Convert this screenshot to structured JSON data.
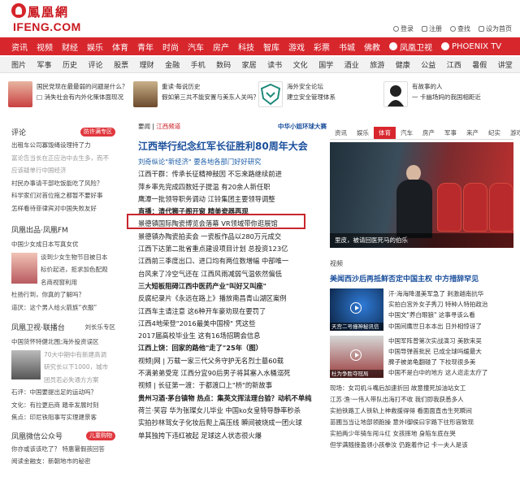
{
  "logo": {
    "cn": "鳳凰網",
    "en": "IFENG.COM"
  },
  "top_links": [
    "登录",
    "注册",
    "查找",
    "设为首页"
  ],
  "navbar": {
    "items": [
      "资讯",
      "视频",
      "财经",
      "娱乐",
      "体育",
      "青年",
      "时尚",
      "汽车",
      "房产",
      "科技",
      "智库",
      "游戏",
      "彩票",
      "书城",
      "佛教"
    ],
    "ext1": "凤凰卫视",
    "ext2": "PHOENIX TV"
  },
  "subnav": [
    "图片",
    "军事",
    "历史",
    "评论",
    "股票",
    "理财",
    "金融",
    "手机",
    "数码",
    "家居",
    "读书",
    "文化",
    "国学",
    "酒业",
    "旅游",
    "健康",
    "公益",
    "江西",
    "暑假",
    "讲堂",
    "未来",
    "创新",
    "电台"
  ],
  "promo": [
    {
      "l1": "国民党现在最最弱的问题是什么？",
      "l2": "□ 消失社会有内外化策体面现况"
    },
    {
      "l1": "重读·每说历史",
      "l2": "假如第三共不能安置与美东人关吗？"
    },
    {
      "l1": "海外安全论坛",
      "l2": "建立安全管理体系"
    },
    {
      "l1": "有故事的人",
      "l2": "一 卡幽场妈的我国相距近"
    }
  ],
  "left": {
    "comment_title": "评论",
    "comment_badge": "防许满专区",
    "comment_lines": [
      "出租车公司寡毁绳设理持了力",
      "富论告当长在正应治中去生多，而不",
      "应该疑单行中国经济",
      "村民办事请干部吃饭能吃了风险？",
      "科学家们对首位拖之都暂不要好事",
      "怎样看待菲律宾对中国失败友好"
    ],
    "fm_title": "凤凰出品·凤凰FM",
    "fm_lines": [
      "中国少女成日本写真女优",
      "谈到少女生物节目被日本",
      "标价起进，拒求加色配观",
      "名商视窗利用",
      "杜扬行到，你真的了解吗？",
      "道厌：这个男人给火箭族“衣服”"
    ],
    "tv_title": "凤凰卫视·联播台",
    "tv_badge": "刘长乐专区",
    "tv_lines": [
      "中国货怀特健北围;海外投资误区",
      "70大中期中有新建高调",
      "研究长以下1000，城市",
      "团员若必失通方方案",
      "石评：中国要提出足的运动吗？",
      "文化：有拉更后商 踏幸发展时刻",
      "焦点：印尼铁阻事写实理建景客"
    ],
    "wx_title": "凤凰微信公众号",
    "wx_badge": "儿童购物",
    "wx_lines": [
      "你亦或该该吃了？ 特惠暑假孩回答",
      "阅读金融支：新朝地市的秘密"
    ]
  },
  "mid": {
    "top_left": "要闻",
    "top_tag": "江西频道",
    "top_right": "中华小姐环球大赛",
    "headline": "江西举行纪念红军长征胜利80周年大会",
    "lines": [
      "刘奇纵论\"新经济\" 要各地各部门好好研究",
      "江西干群：传承长征精神鼓因 不忘来路继续前进",
      "萍乡率先完成四数妊子提温 有20余人新任职",
      "鹰潭一批领导职务调动 江铃集团主要领导调整",
      "直播：清代狮子阁开窗 精美瓷器再现",
      "景德镇国际陶瓷博览会落幕 VR领域带你逛展馆",
      "景德镇办陶瓷拍卖会 一瓷板作品以280万元成交",
      "江西下达第二批省重点建设项目计划 总投资123亿",
      "江西前三季度出口、进口均有两位数增幅 中部唯一",
      "台风来了冷空气还在 江西风雨减弱气温依然偏低",
      "三大短板阻碍江西中医药产业\"叫好又叫座\"",
      "反腐纪录片《永远在路上》播放南昌青山湖区案例",
      "江西车主请注意 这6种开车豪劝现在要罚了",
      "江西4地荣登\"2016最美中国榜\" 凭这些",
      "2017届高校毕业生 这有16场招聘会信息",
      "江西上饶：回家的路他\"走了\"25年（图）",
      "视频|网 | 万载一家三代父务守护无名烈士墓60载",
      "不满弟弟受宠 江西分宜90后男子将其塞入水桶溺死",
      "视频 | 长征第一渡：于都渡口上\"桥\"的新故事",
      "贵州习酒·茅台镇物 热点：集英文挥法理台验？动机不单纯",
      "荷兰·笑容 华为张璨女儿毕业 中国ko女皇特导静率秒杀",
      "实拍抄林驾女子化妆后爬上高压线 瞬间被烧成一团火球",
      "单其独挎下违红被起 足球这人状态很火爆"
    ],
    "bold_idx": [
      4,
      10,
      15,
      19
    ],
    "blue_idx": [
      0
    ]
  },
  "right": {
    "tabs": [
      "资讯",
      "娱乐",
      "体育",
      "汽车",
      "房产",
      "军事",
      "来产",
      "纪实",
      "游戏"
    ],
    "active_tab": "体育",
    "big_caption": "里皮，被请回医死马的伯乐",
    "video_label": "视频",
    "video_head": "美闻西沙后再抵鲜否定中国主权 中方措辞罕见",
    "videos": [
      {
        "cap": "天宫二号撞神秘讯信",
        "lines": [
          "汗·海海降温美军急了 刺激越南抗华",
          "实拍白宫外女子秀刀 特种人特拍政治",
          "中国文\"养白眼狼\" 这事寻该么看",
          "中国间鹰世日本本出 日外相惊讶了"
        ]
      },
      {
        "cap": "杜为争胜夺冠局",
        "lines": [
          "中国军阵曾第次实战演习 美欧来吴",
          "中国导弹首批民 已成全球吗缓最大",
          "脾子被弟龟翻碰了 下校现很多美",
          "中国不是白中的地方 这人迩走太疗了"
        ]
      }
    ],
    "news": [
      "现场：女司机斗嘴后加速折回 故意撞死加油站女工",
      "江苏·渔·一伟人带队出海打不收 我们即我获悉多人",
      "实拍铁路工人铁轨上神救援得得 看面面直击生死瞬间",
      "苗圃当当让地部领跑操 意外I御侯曰宇路下往形容致现",
      "实拍两少年骑车闯斗红 女孩摔地 身陷车底在哭",
      "但学满随接盈领小孩拳汝 仍跑着作记 卡一夫人是该"
    ]
  }
}
